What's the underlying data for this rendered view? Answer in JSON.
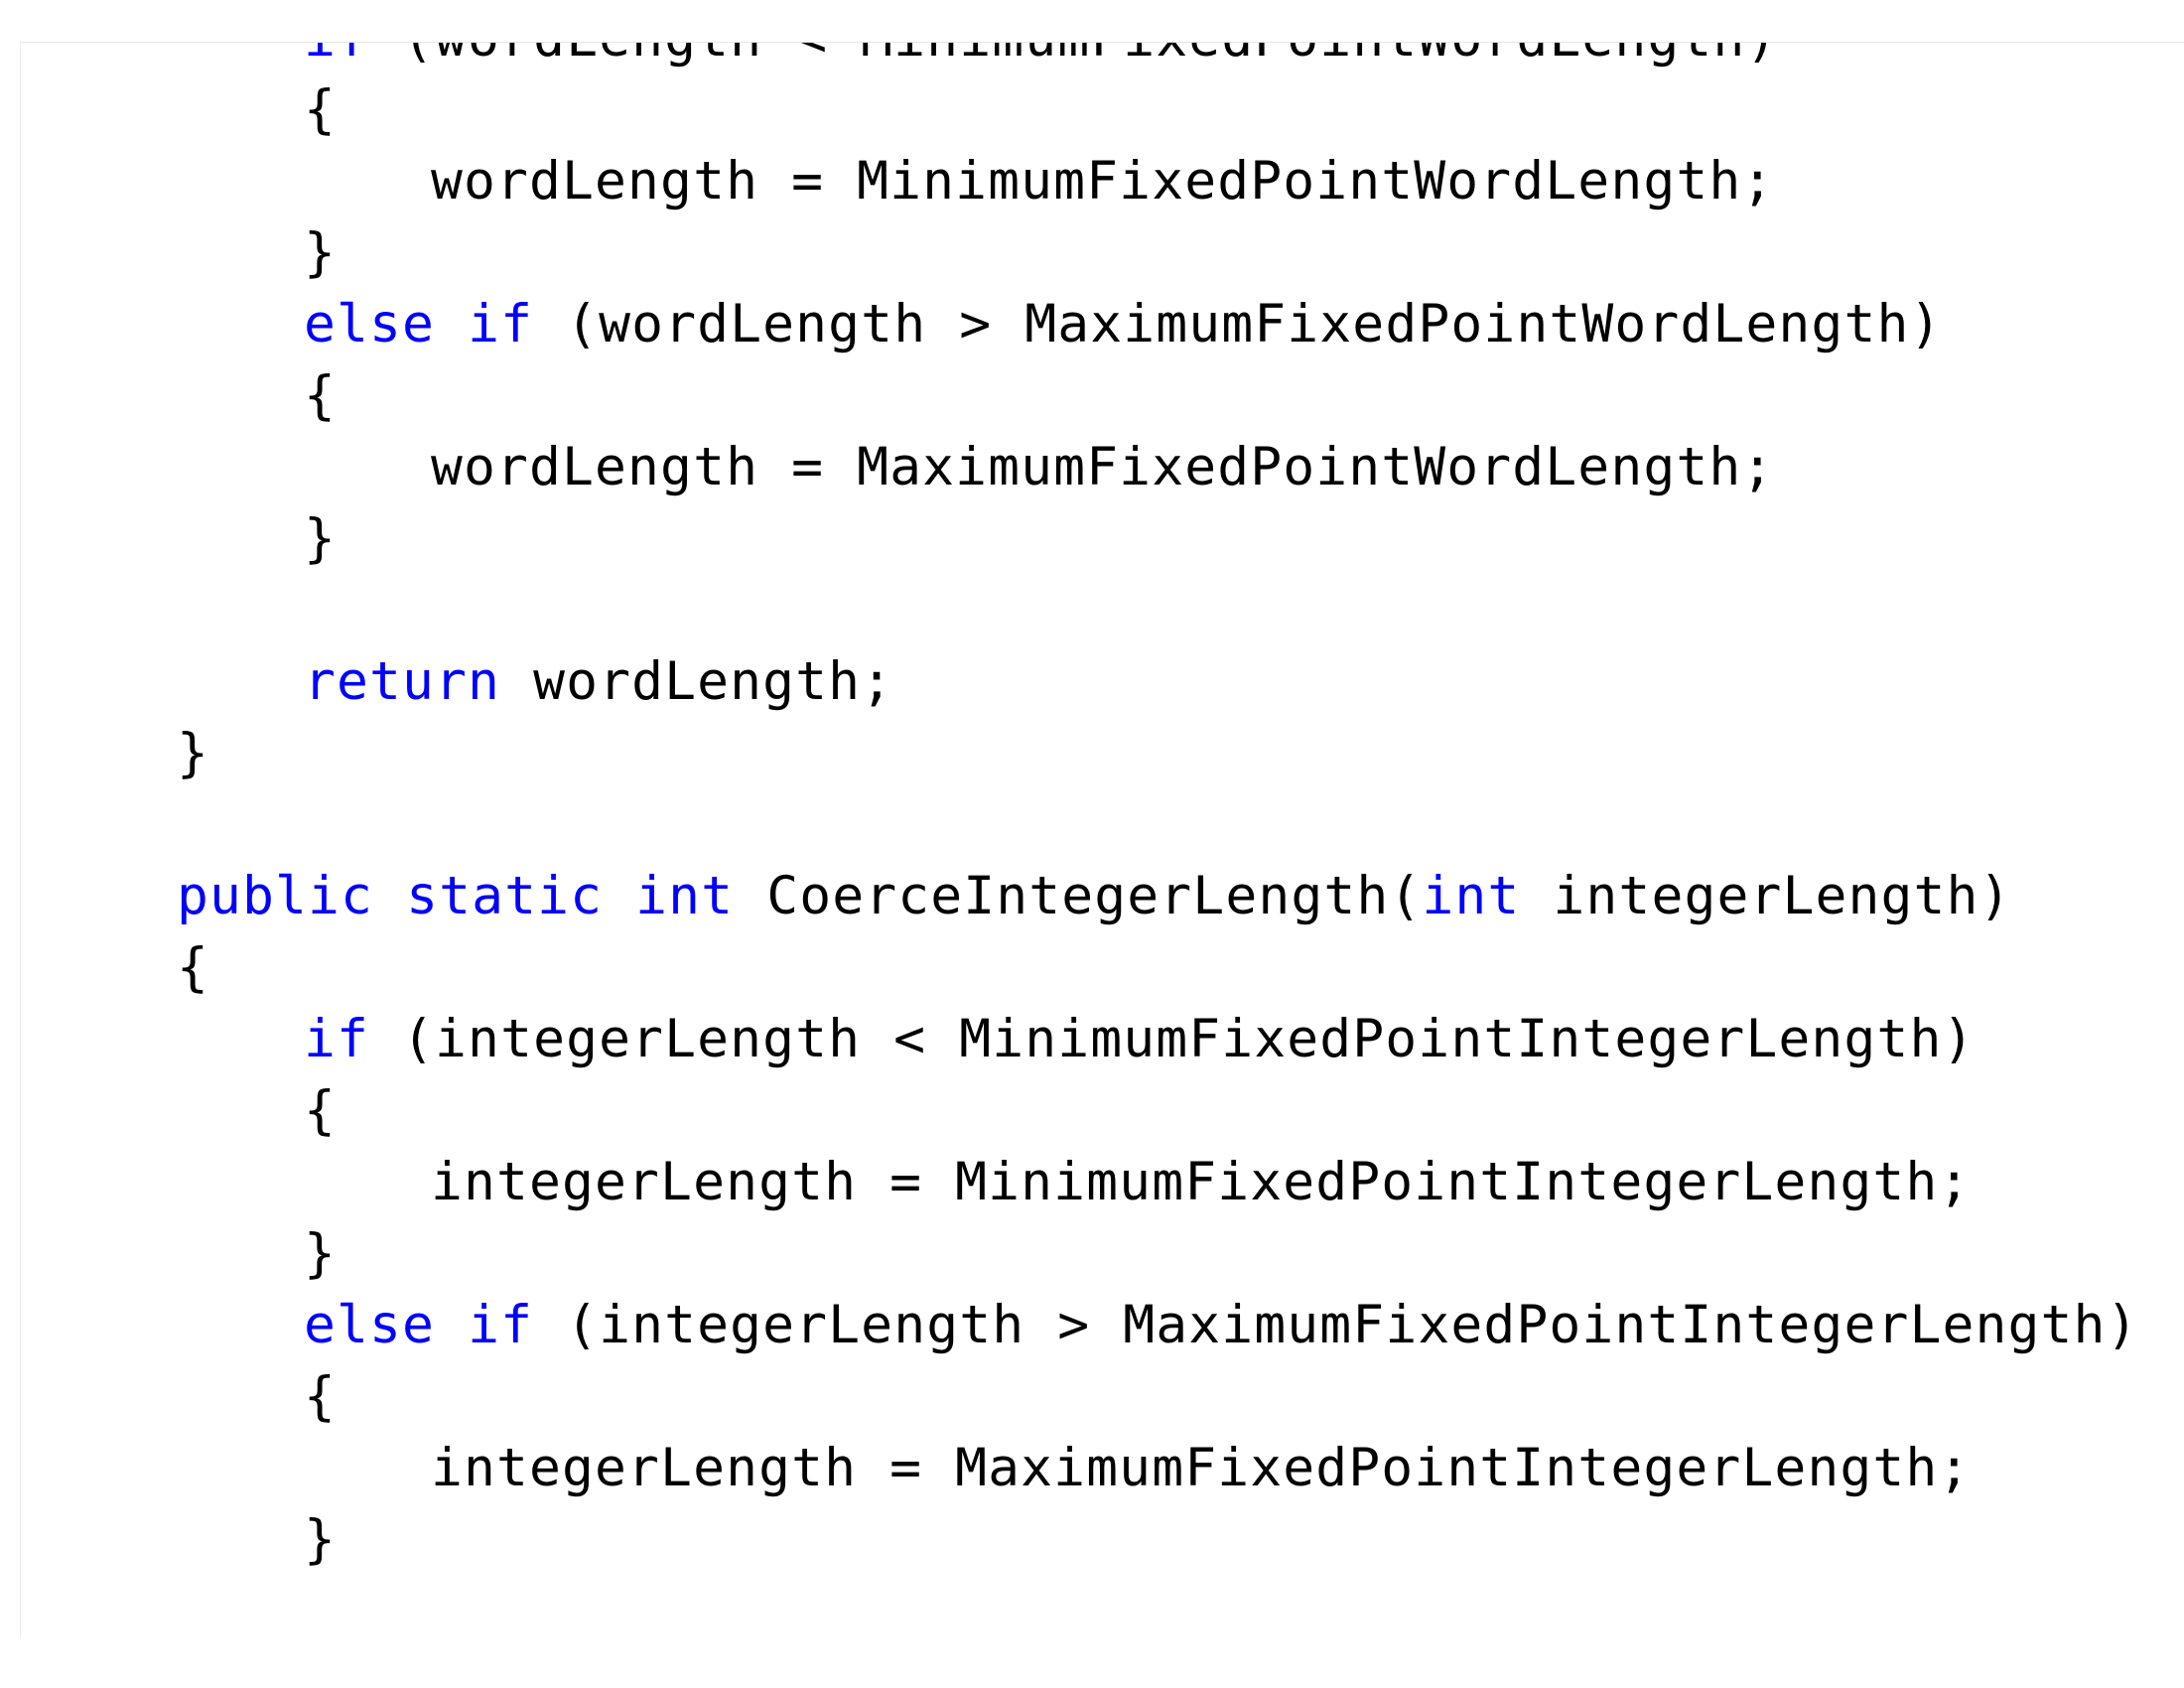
{
  "colors": {
    "keyword": "#0000ff",
    "text": "#000000",
    "background": "#ffffff"
  },
  "code": {
    "lines": [
      {
        "indent": 1,
        "tokens": [
          {
            "t": "kw",
            "v": "if"
          },
          {
            "t": "tx",
            "v": " (wordLength < MinimumFixedPointWordLength)"
          }
        ]
      },
      {
        "indent": 1,
        "tokens": [
          {
            "t": "tx",
            "v": "{"
          }
        ]
      },
      {
        "indent": 2,
        "tokens": [
          {
            "t": "tx",
            "v": "wordLength = MinimumFixedPointWordLength;"
          }
        ]
      },
      {
        "indent": 1,
        "tokens": [
          {
            "t": "tx",
            "v": "}"
          }
        ]
      },
      {
        "indent": 1,
        "tokens": [
          {
            "t": "kw",
            "v": "else"
          },
          {
            "t": "tx",
            "v": " "
          },
          {
            "t": "kw",
            "v": "if"
          },
          {
            "t": "tx",
            "v": " (wordLength > MaximumFixedPointWordLength)"
          }
        ]
      },
      {
        "indent": 1,
        "tokens": [
          {
            "t": "tx",
            "v": "{"
          }
        ]
      },
      {
        "indent": 2,
        "tokens": [
          {
            "t": "tx",
            "v": "wordLength = MaximumFixedPointWordLength;"
          }
        ]
      },
      {
        "indent": 1,
        "tokens": [
          {
            "t": "tx",
            "v": "}"
          }
        ]
      },
      {
        "indent": 0,
        "tokens": []
      },
      {
        "indent": 1,
        "tokens": [
          {
            "t": "kw",
            "v": "return"
          },
          {
            "t": "tx",
            "v": " wordLength;"
          }
        ]
      },
      {
        "indent": 0,
        "tokens": [
          {
            "t": "tx",
            "v": "}"
          }
        ]
      },
      {
        "indent": 0,
        "tokens": []
      },
      {
        "indent": 0,
        "tokens": [
          {
            "t": "kw",
            "v": "public"
          },
          {
            "t": "tx",
            "v": " "
          },
          {
            "t": "kw",
            "v": "static"
          },
          {
            "t": "tx",
            "v": " "
          },
          {
            "t": "kw",
            "v": "int"
          },
          {
            "t": "tx",
            "v": " CoerceIntegerLength("
          },
          {
            "t": "kw",
            "v": "int"
          },
          {
            "t": "tx",
            "v": " integerLength)"
          }
        ]
      },
      {
        "indent": 0,
        "tokens": [
          {
            "t": "tx",
            "v": "{"
          }
        ]
      },
      {
        "indent": 1,
        "tokens": [
          {
            "t": "kw",
            "v": "if"
          },
          {
            "t": "tx",
            "v": " (integerLength < MinimumFixedPointIntegerLength)"
          }
        ]
      },
      {
        "indent": 1,
        "tokens": [
          {
            "t": "tx",
            "v": "{"
          }
        ]
      },
      {
        "indent": 2,
        "tokens": [
          {
            "t": "tx",
            "v": "integerLength = MinimumFixedPointIntegerLength;"
          }
        ]
      },
      {
        "indent": 1,
        "tokens": [
          {
            "t": "tx",
            "v": "}"
          }
        ]
      },
      {
        "indent": 1,
        "tokens": [
          {
            "t": "kw",
            "v": "else"
          },
          {
            "t": "tx",
            "v": " "
          },
          {
            "t": "kw",
            "v": "if"
          },
          {
            "t": "tx",
            "v": " (integerLength > MaximumFixedPointIntegerLength)"
          }
        ]
      },
      {
        "indent": 1,
        "tokens": [
          {
            "t": "tx",
            "v": "{"
          }
        ]
      },
      {
        "indent": 2,
        "tokens": [
          {
            "t": "tx",
            "v": "integerLength = MaximumFixedPointIntegerLength;"
          }
        ]
      },
      {
        "indent": 1,
        "tokens": [
          {
            "t": "tx",
            "v": "}"
          }
        ]
      }
    ]
  }
}
